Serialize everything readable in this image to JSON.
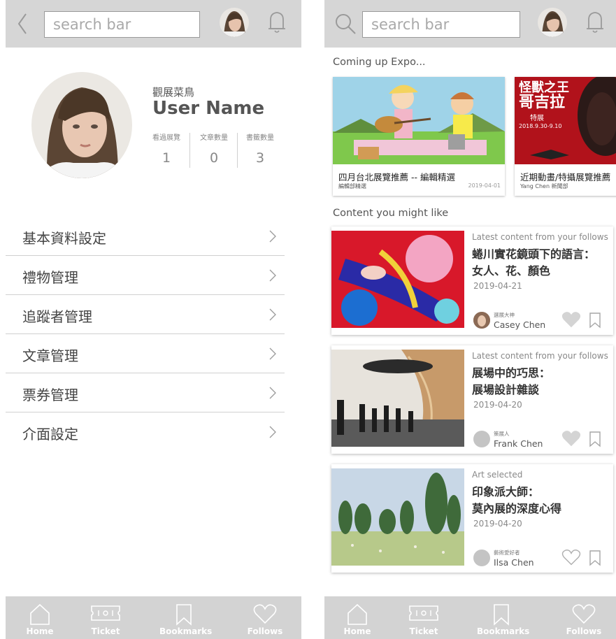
{
  "left": {
    "search": {
      "placeholder": "search bar"
    },
    "profile": {
      "nickname": "觀展菜鳥",
      "username": "User Name",
      "stats": [
        {
          "label": "看過展覽",
          "value": "1"
        },
        {
          "label": "文章數量",
          "value": "0"
        },
        {
          "label": "書籤數量",
          "value": "3"
        }
      ]
    },
    "menu": [
      "基本資料設定",
      "禮物管理",
      "追蹤者管理",
      "文章管理",
      "票券管理",
      "介面設定"
    ]
  },
  "right": {
    "search": {
      "placeholder": "search bar"
    },
    "coming_up": {
      "heading": "Coming up Expo...",
      "items": [
        {
          "title": "四月台北展覽推薦 -- 編輯精選",
          "source": "編輯部精選",
          "date": "2019-04-01"
        },
        {
          "title": "近期動畫/特攝展覽推薦",
          "source": "Yang Chen  新聞部",
          "date": "",
          "poster_text": [
            "怪獸之王",
            "哥吉拉",
            "特展",
            "2018.9.30-9.10"
          ]
        }
      ]
    },
    "content": {
      "heading": "Content you might like",
      "cards": [
        {
          "category": "Latest content from your follows",
          "title_line1": "蜷川實花鏡頭下的語言：",
          "title_line2": "女人、花、顏色",
          "date": "2019-04-21",
          "author_role": "選展大神",
          "author": "Casey Chen",
          "liked": true
        },
        {
          "category": "Latest content from your follows",
          "title_line1": "展場中的巧思：",
          "title_line2": "展場設計雜談",
          "date": "2019-04-20",
          "author_role": "策展人",
          "author": "Frank Chen",
          "liked": true
        },
        {
          "category": "Art selected",
          "title_line1": "印象派大師：",
          "title_line2": "莫內展的深度心得",
          "date": "2019-04-20",
          "author_role": "藝術愛好者",
          "author": "Ilsa Chen",
          "liked": false
        }
      ]
    }
  },
  "tabs": [
    {
      "label": "Home",
      "icon": "home-icon"
    },
    {
      "label": "Ticket",
      "icon": "ticket-icon"
    },
    {
      "label": "Bookmarks",
      "icon": "bookmark-icon"
    },
    {
      "label": "Follows",
      "icon": "heart-icon"
    }
  ],
  "colors": {
    "bar": "#d6d6d6",
    "tabbar": "#d3d3d3",
    "divider": "#d0d0d0",
    "icon": "#9a9a9a",
    "like": "#d4d4d4"
  }
}
